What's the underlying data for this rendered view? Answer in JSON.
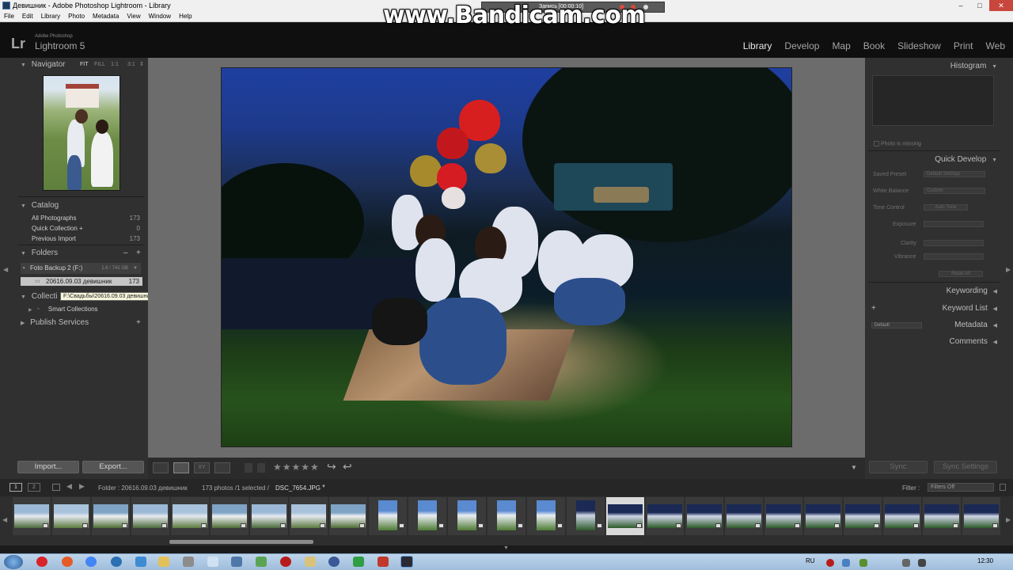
{
  "window": {
    "title": "Девишник - Adobe Photoshop Lightroom - Library",
    "controls": [
      "–",
      "□",
      "✕"
    ]
  },
  "menu": [
    "File",
    "Edit",
    "Library",
    "Photo",
    "Metadata",
    "View",
    "Window",
    "Help"
  ],
  "overlay": {
    "logo": "www.Bandicam.com",
    "recording": "Запись [00:00:10]"
  },
  "app": {
    "brand_small": "Adobe Photoshop",
    "brand": "Lightroom 5",
    "logo_letters": "Lr"
  },
  "modules": [
    {
      "label": "Library",
      "active": true
    },
    {
      "label": "Develop",
      "active": false
    },
    {
      "label": "Map",
      "active": false
    },
    {
      "label": "Book",
      "active": false
    },
    {
      "label": "Slideshow",
      "active": false
    },
    {
      "label": "Print",
      "active": false
    },
    {
      "label": "Web",
      "active": false
    }
  ],
  "navigator": {
    "title": "Navigator",
    "zoom": [
      "FIT",
      "FILL",
      "1:1",
      "3:1"
    ]
  },
  "catalog": {
    "title": "Catalog",
    "items": [
      {
        "label": "All Photographs",
        "count": "173"
      },
      {
        "label": "Quick Collection +",
        "count": "0"
      },
      {
        "label": "Previous Import",
        "count": "173"
      }
    ]
  },
  "folders": {
    "title": "Folders",
    "add": "+",
    "remove": "–",
    "volume": {
      "label": "Foto Backup 2 (F:)",
      "space": "1.6 / 741 GB"
    },
    "folder": {
      "label": "20616.09.03 девишник",
      "count": "173"
    },
    "tooltip": "F:\\Свадьбы\\20616.09.03 девишник"
  },
  "collections": {
    "title": "Collections",
    "visible_title": "Collecti",
    "add": "+",
    "smart": "Smart Collections"
  },
  "publish": {
    "title": "Publish Services",
    "add": "+"
  },
  "buttons": {
    "import": "Import...",
    "export": "Export..."
  },
  "histogram": {
    "title": "Histogram",
    "message": "Photo is missing"
  },
  "quick_develop": {
    "title": "Quick Develop",
    "saved_preset": {
      "label": "Saved Preset",
      "value": "Default Settings"
    },
    "white_balance": {
      "label": "White Balance",
      "value": "Custom"
    },
    "tone_control": {
      "label": "Tone Control",
      "value": "Auto Tone"
    },
    "exposure": "Exposure",
    "clarity": "Clarity",
    "vibrance": "Vibrance",
    "reset": "Reset All"
  },
  "right_sections": {
    "keywording": "Keywording",
    "keyword_list": "Keyword List",
    "metadata": "Metadata",
    "metadata_preset": "Default",
    "comments": "Comments",
    "add": "+"
  },
  "sync": {
    "sync": "Sync",
    "sync_settings": "Sync Settings"
  },
  "toolbar": {
    "rating": "★★★★★",
    "rotate_left": "↪",
    "rotate_right": "↩"
  },
  "filmstrip": {
    "pages": [
      "1",
      "2"
    ],
    "path": "Folder : 20616.09.03 девишник",
    "count": "173 photos /1 selected /",
    "filename": "DSC_7654.JPG",
    "filter_label": "Filter :",
    "filter_value": "Filters Off",
    "thumbnail_count": 25,
    "selected_index": 15
  },
  "taskbar": {
    "lang": "RU",
    "time": "12:30"
  },
  "colors": {
    "panel_bg": "#303030",
    "center_bg": "#6c6c6c",
    "header_bg": "#0f0f0f",
    "taskbar_blue": "#a9c5e2"
  }
}
